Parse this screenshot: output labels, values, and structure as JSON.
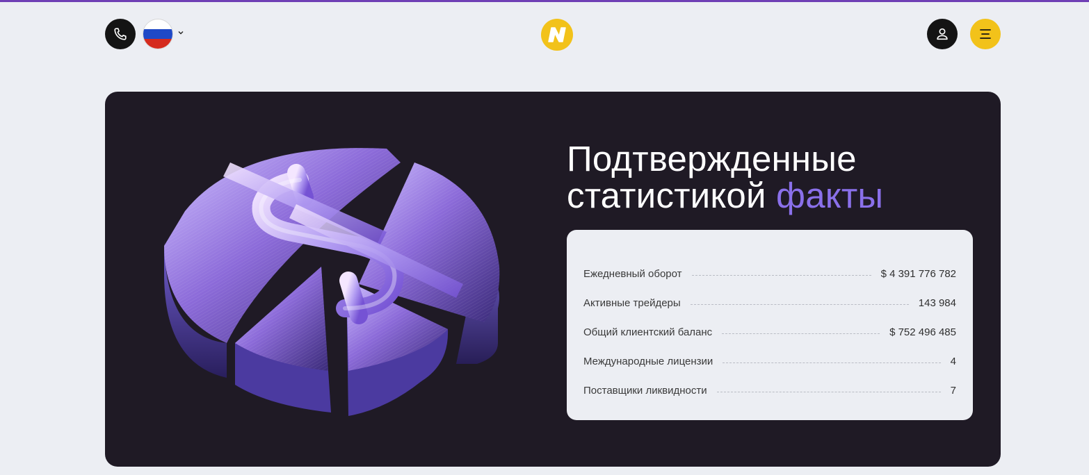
{
  "header": {
    "phone_icon": "phone-icon",
    "language": {
      "selected": "RU",
      "flag_colors": [
        "#ffffff",
        "#1f49c7",
        "#d52b1e"
      ]
    },
    "logo_letter": "N",
    "user_icon": "user-icon",
    "menu_icon": "menu-icon"
  },
  "hero": {
    "title_line1": "Подтвержденные",
    "title_line2_start": "статистикой",
    "title_accent": "факты",
    "stats": [
      {
        "label": "Ежедневный оборот",
        "value": "$ 4 391 776 782"
      },
      {
        "label": "Активные трейдеры",
        "value": "143 984"
      },
      {
        "label": "Общий клиентский баланс",
        "value": "$ 752 496 485"
      },
      {
        "label": "Международные лицензии",
        "value": "4"
      },
      {
        "label": "Поставщики ликвидности",
        "value": "7"
      }
    ]
  },
  "colors": {
    "background": "#eceef3",
    "hero_background": "#1f1a25",
    "accent_purple": "#8a70ea",
    "brand_yellow": "#f2c21a",
    "dark": "#141414",
    "top_bar": "#6f3fb5"
  }
}
